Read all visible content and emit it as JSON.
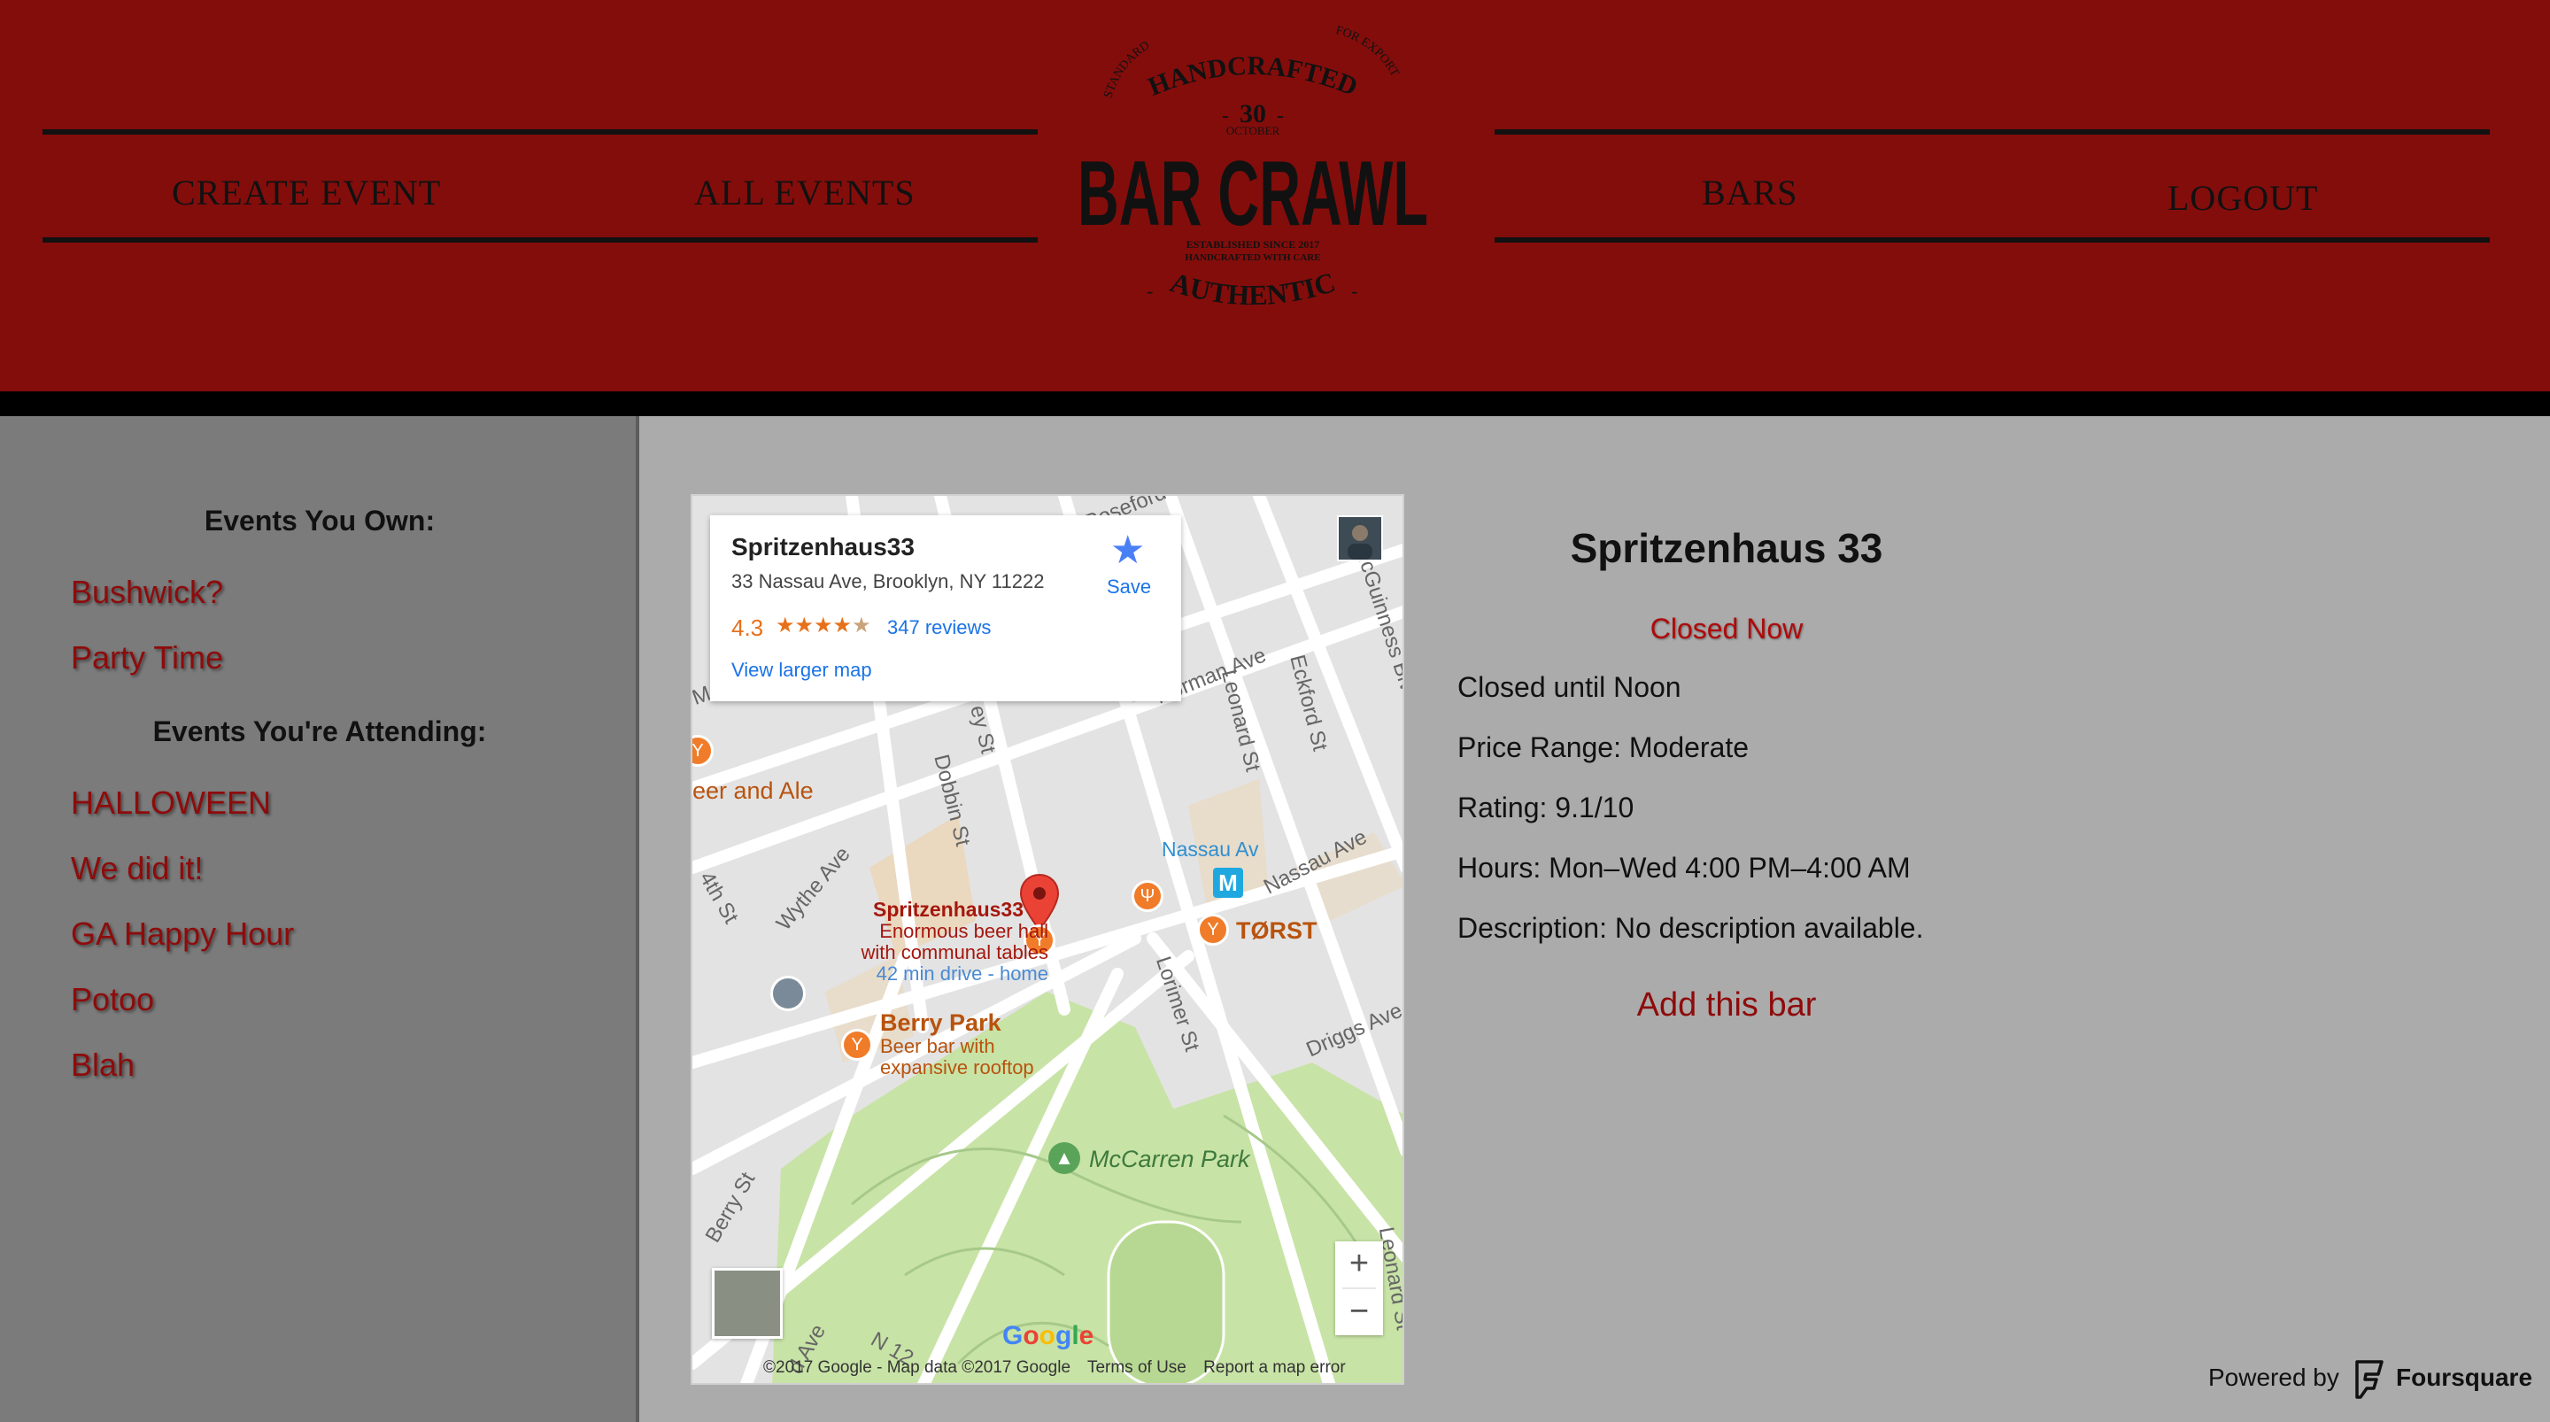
{
  "header": {
    "nav_left": [
      "CREATE EVENT",
      "ALL EVENTS"
    ],
    "nav_right": [
      "BARS",
      "LOGOUT"
    ],
    "logo": {
      "top_arc": "HANDCRAFTED",
      "left_small": "STANDARD",
      "right_small": "FOR EXPORT",
      "number": "30",
      "month": "OCTOBER",
      "title": "BAR CRAWL",
      "established": "ESTABLISHED SINCE 2017",
      "care": "HANDCRAFTED WITH CARE",
      "bottom": "AUTHENTIC"
    }
  },
  "sidebar": {
    "owned_heading": "Events You Own:",
    "owned": [
      "Bushwick?",
      "Party Time"
    ],
    "attending_heading": "Events You're Attending:",
    "attending": [
      "HALLOWEEN",
      "We did it!",
      "GA Happy Hour",
      "Potoo",
      "Blah"
    ]
  },
  "map": {
    "card": {
      "name": "Spritzenhaus33",
      "address": "33 Nassau Ave, Brooklyn, NY 11222",
      "rating": "4.3",
      "stars": 4.3,
      "reviews": "347 reviews",
      "view_larger": "View larger map",
      "save": "Save"
    },
    "streets": [
      "Norman Ave",
      "Leonard St",
      "Eckford St",
      "McGuinness Blvd",
      "Dobbin St",
      "Wythe Ave",
      "Nassau Ave",
      "Lorimer St",
      "Driggs Ave",
      "Berry St",
      "N 12",
      "Lorimer St",
      "Lorimer St",
      "ey St",
      "4th St",
      "d Ave"
    ],
    "street_labels": {
      "norman": "Norman Ave",
      "leonard": "Leonard St",
      "eckford": "Eckford St",
      "mcguinness": "McGuinness Blvd",
      "dobbin": "Dobbin St",
      "wythe": "Wythe Ave",
      "nassau": "Nassau Ave",
      "lorimer": "Lorimer St",
      "driggs": "Driggs Ave",
      "berry": "Berry St",
      "n12": "N 12",
      "leonard_s": "Leonard St",
      "frag_ey": "ey St",
      "frag_4th": "4th St",
      "frag_ave": "d Ave",
      "frag_me": "Me",
      "frag_roseford": "Roseford"
    },
    "pois": {
      "beer_ale": "eer and Ale",
      "spritz_name": "Spritzenhaus33",
      "spritz_sub1": "Enormous beer hall",
      "spritz_sub2": "with communal tables",
      "spritz_drive": "42 min drive - home",
      "nassau_av": "Nassau Av",
      "metro": "M",
      "torst": "TØRST",
      "berry_park": "Berry Park",
      "berry_sub1": "Beer bar with",
      "berry_sub2": "expansive rooftop",
      "mccarren": "McCarren Park"
    },
    "google": "Google",
    "footer": {
      "copyright": "©2017 Google - Map data ©2017 Google",
      "terms": "Terms of Use",
      "report": "Report a map error"
    },
    "zoom_in": "+",
    "zoom_out": "−"
  },
  "details": {
    "title": "Spritzenhaus 33",
    "status": "Closed Now",
    "closed_until": "Closed until Noon",
    "price": "Price Range: Moderate",
    "rating": "Rating: 9.1/10",
    "hours": "Hours: Mon–Wed 4:00 PM–4:00 AM",
    "description": "Description: No description available.",
    "add_button": "Add this bar"
  },
  "footer": {
    "powered_by": "Powered by",
    "brand": "Foursquare"
  },
  "colors": {
    "header": "#830d0b",
    "accent_text": "#8e0b0b",
    "sidebar": "#7b7b7b",
    "content": "#ababab",
    "park": "#c8e3a6",
    "poi": "#f07c2a"
  }
}
